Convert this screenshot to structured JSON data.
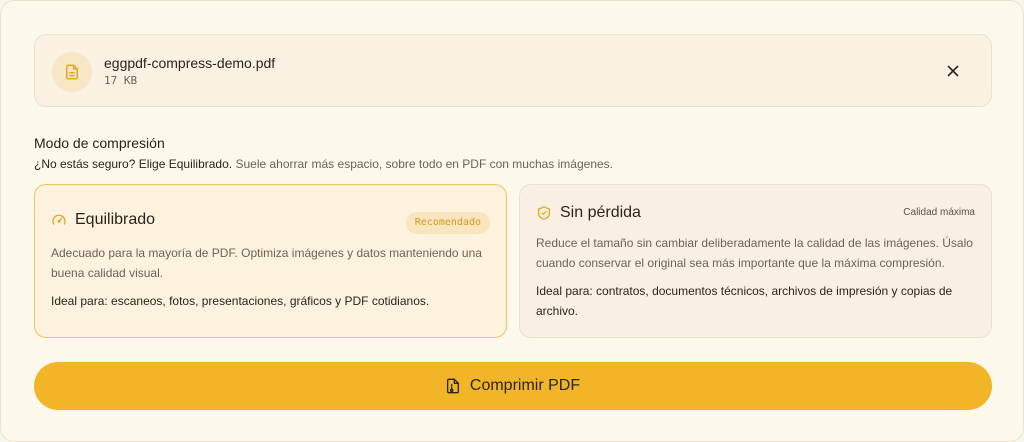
{
  "file": {
    "name": "eggpdf-compress-demo.pdf",
    "size": "17 KB",
    "icon": "document-icon",
    "close_icon": "close-icon"
  },
  "compression": {
    "title": "Modo de compresión",
    "hint_strong": "¿No estás seguro? Elige Equilibrado.",
    "hint_rest": "Suele ahorrar más espacio, sobre todo en PDF con muchas imágenes."
  },
  "modes": [
    {
      "title": "Equilibrado",
      "icon": "gauge-icon",
      "badge": "Recomendado",
      "selected": true,
      "description": "Adecuado para la mayoría de PDF. Optimiza imágenes y datos manteniendo una buena calidad visual.",
      "ideal": "Ideal para: escaneos, fotos, presentaciones, gráficos y PDF cotidianos."
    },
    {
      "title": "Sin pérdida",
      "icon": "shield-check-icon",
      "badge": "Calidad máxima",
      "selected": false,
      "description": "Reduce el tamaño sin cambiar deliberadamente la calidad de las imágenes. Úsalo cuando conservar el original sea más importante que la máxima compresión.",
      "ideal": "Ideal para: contratos, documentos técnicos, archivos de impresión y copias de archivo."
    }
  ],
  "action": {
    "label": "Comprimir PDF",
    "icon": "file-compress-icon"
  },
  "colors": {
    "accent": "#f2b528",
    "badge_text": "#d39a1f",
    "selected_border": "#f0c55a"
  }
}
